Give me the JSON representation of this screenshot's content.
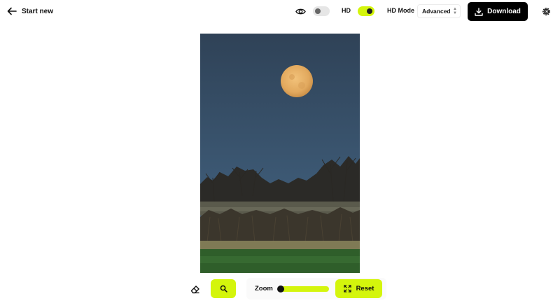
{
  "header": {
    "back_label": "Start new",
    "hd_label": "HD",
    "hd_mode_label": "HD Mode",
    "hd_mode_value": "Advanced",
    "download_label": "Download",
    "preview_toggle_on": false,
    "hd_toggle_on": true
  },
  "toolbar": {
    "zoom_label": "Zoom",
    "reset_label": "Reset",
    "zoom_level": 0
  },
  "icons": {
    "back": "arrow-left-icon",
    "preview": "eye-icon",
    "download": "download-icon",
    "settings": "gear-icon",
    "eraser": "eraser-icon",
    "search": "search-icon",
    "reset": "expand-icon"
  },
  "colors": {
    "accent": "#d4f50c",
    "primary_button": "#000000",
    "sky": "#3a5068",
    "moon": "#e8b56a"
  }
}
